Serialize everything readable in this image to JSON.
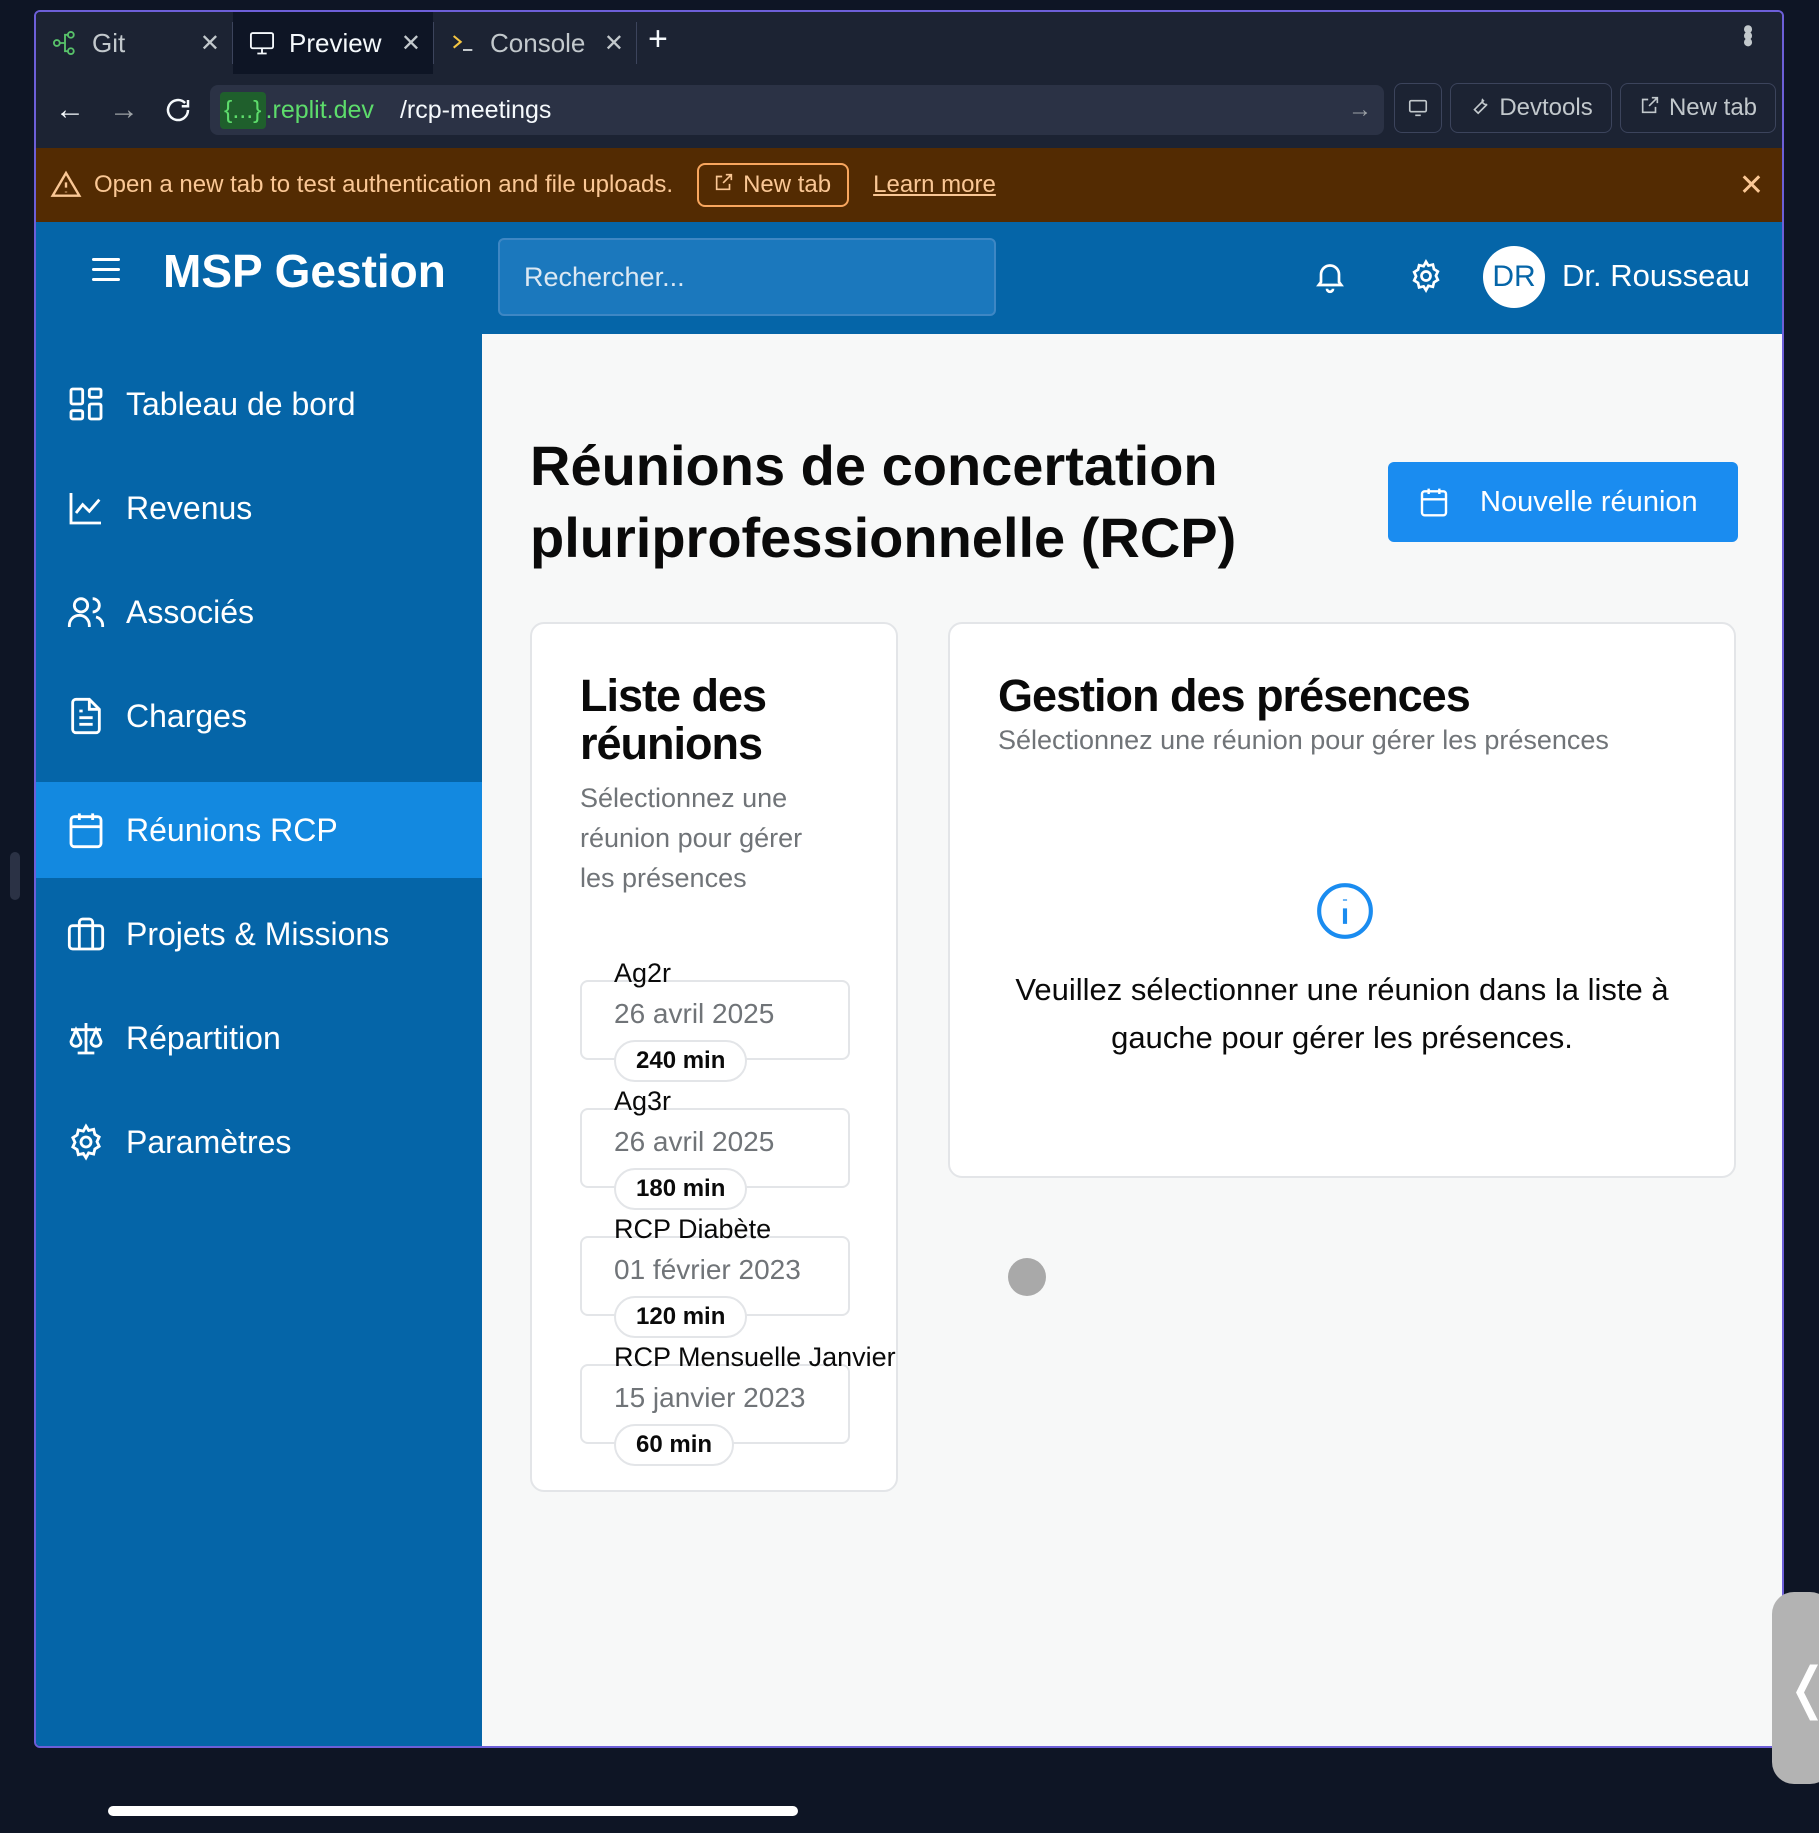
{
  "browser": {
    "tabs": [
      {
        "label": "Git",
        "icon": "git-icon"
      },
      {
        "label": "Preview",
        "icon": "monitor-icon"
      },
      {
        "label": "Console",
        "icon": "terminal-icon"
      }
    ],
    "url_host": "{...}",
    "url_domain": ".replit.dev",
    "url_path": "/rcp-meetings",
    "devtools_label": "Devtools",
    "newtab_label": "New tab"
  },
  "banner": {
    "message": "Open a new tab to test authentication and file uploads.",
    "new_tab": "New tab",
    "learn_more": "Learn more"
  },
  "app": {
    "brand": "MSP Gestion",
    "search_placeholder": "Rechercher...",
    "user_initials": "DR",
    "user_name": "Dr. Rousseau",
    "colors": {
      "primary": "#0565a8",
      "active": "#1389e0",
      "button": "#1a8cf0"
    }
  },
  "sidebar": {
    "items": [
      {
        "label": "Tableau de bord",
        "icon": "dashboard-icon"
      },
      {
        "label": "Revenus",
        "icon": "line-chart-icon"
      },
      {
        "label": "Associés",
        "icon": "users-icon"
      },
      {
        "label": "Charges",
        "icon": "file-text-icon"
      },
      {
        "label": "Réunions RCP",
        "icon": "calendar-icon",
        "active": true
      },
      {
        "label": "Projets & Missions",
        "icon": "briefcase-icon"
      },
      {
        "label": "Répartition",
        "icon": "scale-icon"
      },
      {
        "label": "Paramètres",
        "icon": "gear-icon"
      }
    ]
  },
  "main": {
    "title_line1": "Réunions de concertation",
    "title_line2": "pluriprofessionnelle (RCP)",
    "new_meeting": "Nouvelle réunion",
    "list_card": {
      "title_line1": "Liste des",
      "title_line2": "réunions",
      "sub_line1": "Sélectionnez une",
      "sub_line2": "réunion pour gérer",
      "sub_line3": "les présences",
      "meetings": [
        {
          "name": "Ag2r",
          "date": "26 avril 2025",
          "duration": "240 min"
        },
        {
          "name": "Ag3r",
          "date": "26 avril 2025",
          "duration": "180 min"
        },
        {
          "name": "RCP Diabète",
          "date": "01 février 2023",
          "duration": "120 min"
        },
        {
          "name": "RCP Mensuelle Janvier",
          "date": "15 janvier 2023",
          "duration": "60 min"
        }
      ]
    },
    "attendance_card": {
      "title": "Gestion des présences",
      "subtitle": "Sélectionnez une réunion pour gérer les présences",
      "empty_line1": "Veuillez sélectionner une réunion dans la liste à",
      "empty_line2": "gauche pour gérer les présences."
    }
  }
}
